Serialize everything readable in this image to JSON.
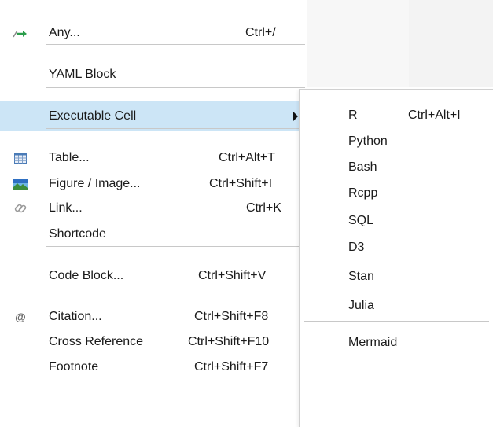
{
  "menu": {
    "items": [
      {
        "label": "Any...",
        "shortcut": "Ctrl+/",
        "icon": "insert-arrow-icon"
      },
      {
        "label": "YAML Block",
        "shortcut": ""
      },
      {
        "label": "Executable Cell",
        "shortcut": "",
        "has_submenu": true
      },
      {
        "label": "Table...",
        "shortcut": "Ctrl+Alt+T",
        "icon": "table-icon"
      },
      {
        "label": "Figure / Image...",
        "shortcut": "Ctrl+Shift+I",
        "icon": "image-icon"
      },
      {
        "label": "Link...",
        "shortcut": "Ctrl+K",
        "icon": "link-icon"
      },
      {
        "label": "Shortcode",
        "shortcut": ""
      },
      {
        "label": "Code Block...",
        "shortcut": "Ctrl+Shift+V"
      },
      {
        "label": "Citation...",
        "shortcut": "Ctrl+Shift+F8",
        "icon": "at-icon"
      },
      {
        "label": "Cross Reference",
        "shortcut": "Ctrl+Shift+F10"
      },
      {
        "label": "Footnote",
        "shortcut": "Ctrl+Shift+F7"
      }
    ]
  },
  "submenu": {
    "items": [
      {
        "label": "R",
        "shortcut": "Ctrl+Alt+I"
      },
      {
        "label": "Python",
        "shortcut": ""
      },
      {
        "label": "Bash",
        "shortcut": ""
      },
      {
        "label": "Rcpp",
        "shortcut": ""
      },
      {
        "label": "SQL",
        "shortcut": ""
      },
      {
        "label": "D3",
        "shortcut": ""
      },
      {
        "label": "Stan",
        "shortcut": ""
      },
      {
        "label": "Julia",
        "shortcut": ""
      },
      {
        "label": "Mermaid",
        "shortcut": ""
      }
    ]
  },
  "colors": {
    "highlight": "#cce5f6",
    "separator": "#c8c8c8",
    "insert_arrow_green": "#2a9d4a",
    "table_blue": "#4a7bb7",
    "image_blue": "#2e6fc2"
  }
}
